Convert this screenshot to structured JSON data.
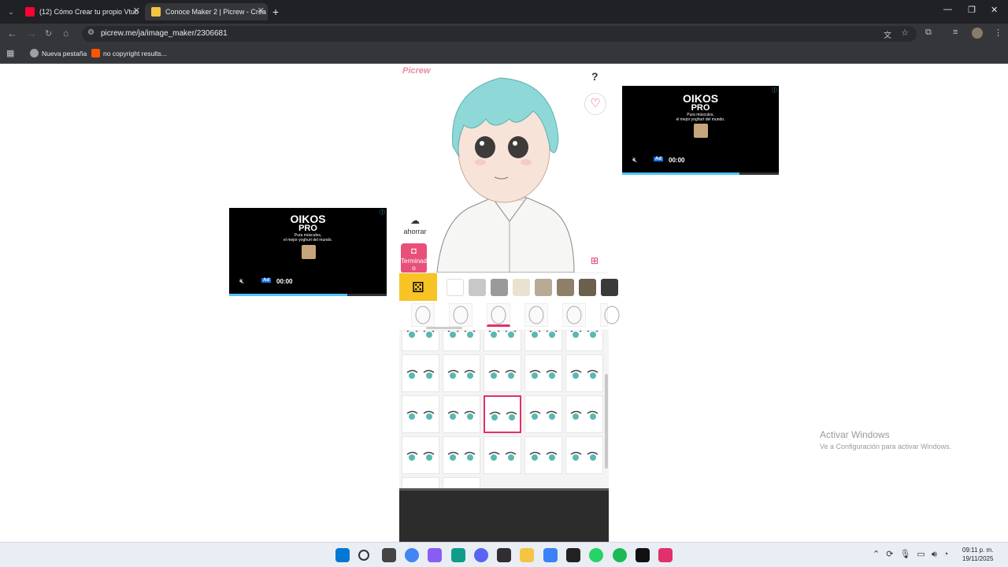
{
  "browser": {
    "tabs": [
      {
        "title": "(12) Cómo Crear tu propio Vtub",
        "active": false,
        "favicon_color": "#ff0033"
      },
      {
        "title": "Conoce Maker 2 | Picrew - Crea",
        "active": true,
        "favicon_color": "#f4c542"
      }
    ],
    "url": "picrew.me/ja/image_maker/2306681",
    "bookmarks": [
      "Nueva pestaña",
      "no copyright results..."
    ]
  },
  "ads": [
    {
      "brand": "OIKOS",
      "brand2": "PRO",
      "slogan1": "Pura músculos,",
      "slogan2": "el mejor yoghurt del mundo.",
      "ad_badge": "Ad",
      "time": "00:00",
      "progress": 0.75
    },
    {
      "brand": "OIKOS",
      "brand2": "PRO",
      "slogan1": "Pura músculos,",
      "slogan2": "el mejor yoghurt del mundo.",
      "ad_badge": "Ad",
      "time": "00:00",
      "progress": 0.75
    }
  ],
  "maker": {
    "logo": "Picrew",
    "help": "?",
    "save_label": "ahorrar",
    "done_label": "Terminado",
    "palette_colors": [
      "#ffffff",
      "#c8c8c8",
      "#9a9a9a",
      "#e8e2cf",
      "#b8ab96",
      "#8e7f6b",
      "#6b5f4e",
      "#3a3a3a"
    ],
    "selected_part_index": 2,
    "selected_cell": [
      1,
      2
    ]
  },
  "windows_watermark": {
    "title": "Activar Windows",
    "subtitle": "Ve a Configuración para activar Windows."
  },
  "taskbar": {
    "time": "09:11 p. m.",
    "date": "19/11/2025",
    "apps": [
      "windows-start",
      "search",
      "file-explorer",
      "chrome",
      "copilot",
      "edge",
      "discord",
      "obs",
      "files",
      "store",
      "unity",
      "whatsapp",
      "spotify",
      "tiktok",
      "instagram"
    ]
  }
}
